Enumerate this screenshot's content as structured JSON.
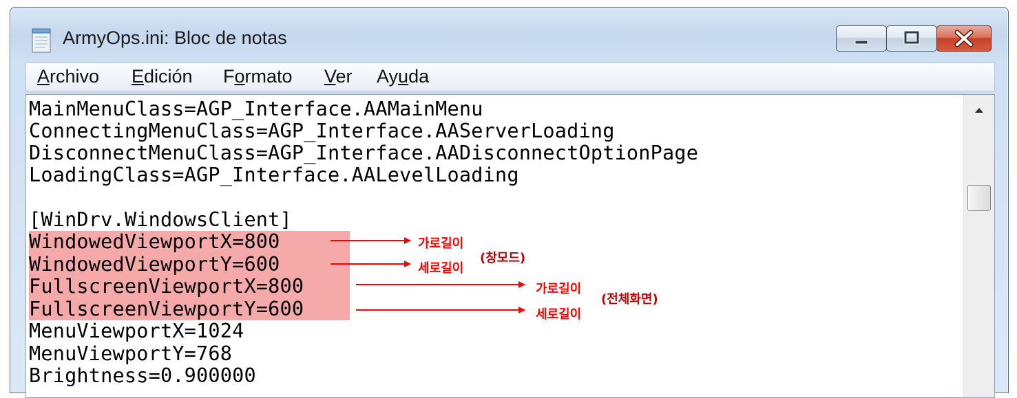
{
  "window": {
    "title": "ArmyOps.ini: Bloc de notas",
    "icon": "notepad-icon",
    "buttons": [
      "minimize-icon",
      "maximize-icon",
      "close-icon"
    ]
  },
  "menu": [
    {
      "label": "Archivo",
      "accel": "A"
    },
    {
      "label": "Edición",
      "accel": "E"
    },
    {
      "label": "Formato",
      "accel": "o"
    },
    {
      "label": "Ver",
      "accel": "V"
    },
    {
      "label": "Ayuda",
      "accel": "u"
    }
  ],
  "editor": {
    "lines": [
      "MainMenuClass=AGP_Interface.AAMainMenu",
      "ConnectingMenuClass=AGP_Interface.AAServerLoading",
      "DisconnectMenuClass=AGP_Interface.AADisconnectOptionPage",
      "LoadingClass=AGP_Interface.AALevelLoading",
      "",
      "[WinDrv.WindowsClient]",
      "WindowedViewportX=800",
      "WindowedViewportY=600",
      "FullscreenViewportX=800",
      "FullscreenViewportY=600",
      "MenuViewportX=1024",
      "MenuViewportY=768",
      "Brightness=0.900000"
    ],
    "highlight_color": "#f6a9a9"
  },
  "annotations": {
    "windowed_width": "가로길이",
    "windowed_height": "세로길이",
    "windowed_group": "(창모드)",
    "fullscreen_width": "가로길이",
    "fullscreen_height": "세로길이",
    "fullscreen_group": "(전체화면)",
    "color": "#ff0000"
  }
}
